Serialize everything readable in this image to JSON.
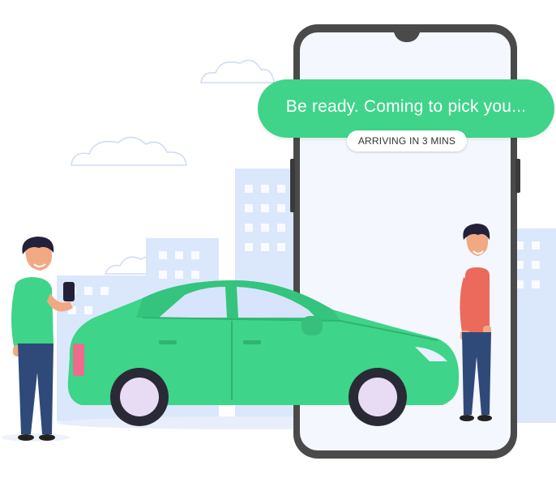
{
  "notification": {
    "message": "Be ready. Coming to pick you...",
    "status": "ARRIVING IN 3 MINS"
  },
  "colors": {
    "accent_green": "#3fd48a",
    "car_green": "#3ed48a",
    "phone_frame": "#4a4a4a",
    "city_blue": "#dbe7fb",
    "wheel_hub": "#e8dcf5"
  }
}
